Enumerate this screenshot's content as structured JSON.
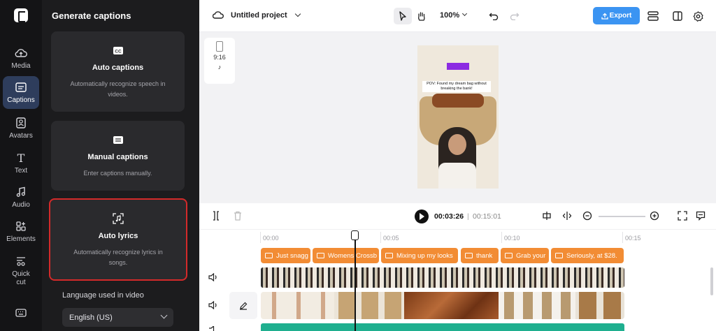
{
  "rail": {
    "items": [
      {
        "label": "Media",
        "icon": "cloud-upload-icon"
      },
      {
        "label": "Captions",
        "icon": "captions-icon"
      },
      {
        "label": "Avatars",
        "icon": "avatar-icon"
      },
      {
        "label": "Text",
        "icon": "text-icon"
      },
      {
        "label": "Audio",
        "icon": "music-note-icon"
      },
      {
        "label": "Elements",
        "icon": "elements-icon"
      },
      {
        "label": "Quick cut",
        "icon": "quick-cut-icon"
      }
    ],
    "active": "Captions"
  },
  "panel": {
    "title": "Generate captions",
    "cards": [
      {
        "title": "Auto captions",
        "desc": "Automatically recognize speech in videos.",
        "icon": "cc-icon"
      },
      {
        "title": "Manual captions",
        "desc": "Enter captions manually.",
        "icon": "keyboard-icon"
      },
      {
        "title": "Auto lyrics",
        "desc": "Automatically recognize lyrics in songs.",
        "icon": "lyrics-icon"
      }
    ],
    "language_label": "Language used in video",
    "language_value": "English (US)"
  },
  "topbar": {
    "project_name": "Untitled project",
    "zoom": "100%",
    "export_label": "Export"
  },
  "canvas": {
    "aspect_ratio": "9:16",
    "platform_icon": "tiktok-icon",
    "caption_text": "POV: Found my dream bag without breaking the bank!"
  },
  "timeline": {
    "current_time": "00:03:26",
    "separator": "|",
    "total_time": "00:15:01",
    "ruler_labels": [
      "00:00",
      "00:05",
      "00:10",
      "00:15"
    ],
    "caption_clips": [
      "Just snagg",
      "Womens Crossb",
      "Mixing up my looks",
      "thank",
      "Grab your",
      "Seriously, at $28."
    ]
  },
  "colors": {
    "accent": "#3b94f2",
    "caption_clip": "#f28c34",
    "audio_track": "#1faf8f",
    "highlight_border": "#d42a2a"
  }
}
